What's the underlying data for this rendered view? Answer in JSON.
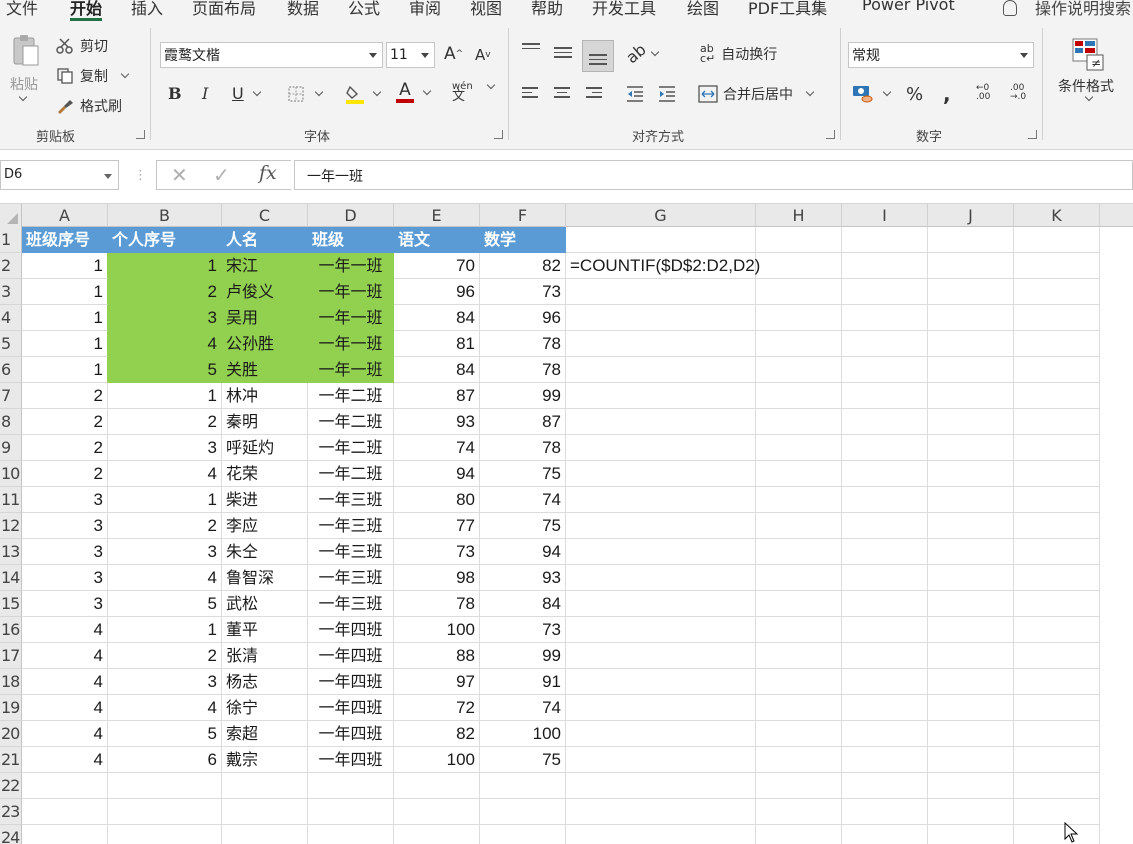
{
  "menu": {
    "tabs": [
      "文件",
      "开始",
      "插入",
      "页面布局",
      "数据",
      "公式",
      "审阅",
      "视图",
      "帮助",
      "开发工具",
      "绘图",
      "PDF工具集",
      "Power Pivot"
    ],
    "active": "开始",
    "search": "操作说明搜索"
  },
  "ribbon": {
    "clipboard": {
      "paste": "粘贴",
      "cut": "剪切",
      "copy": "复制",
      "format_painter": "格式刷",
      "label": "剪贴板"
    },
    "font": {
      "name": "霞鹜文楷",
      "size": "11",
      "bold": "B",
      "italic": "I",
      "underline": "U",
      "label": "字体"
    },
    "alignment": {
      "wrap": "自动换行",
      "merge": "合并后居中",
      "label": "对齐方式"
    },
    "number": {
      "format": "常规",
      "percent": "%",
      "comma": ",",
      "label": "数字"
    },
    "styles": {
      "conditional": "条件格式"
    }
  },
  "formula_bar": {
    "name_box": "D6",
    "formula": "一年一班"
  },
  "columns": [
    "A",
    "B",
    "C",
    "D",
    "E",
    "F",
    "G",
    "H",
    "I",
    "J",
    "K"
  ],
  "row_numbers": [
    "1",
    "2",
    "3",
    "4",
    "5",
    "6",
    "7",
    "8",
    "9",
    "10",
    "11",
    "12",
    "13",
    "14",
    "15",
    "16",
    "17",
    "18",
    "19",
    "20",
    "21",
    "22",
    "23",
    "24"
  ],
  "header_row": [
    "班级序号",
    "个人序号",
    "人名",
    "班级",
    "语文",
    "数学"
  ],
  "rows": [
    [
      "1",
      "1",
      "宋江",
      "一年一班",
      "70",
      "82"
    ],
    [
      "1",
      "2",
      "卢俊义",
      "一年一班",
      "96",
      "73"
    ],
    [
      "1",
      "3",
      "吴用",
      "一年一班",
      "84",
      "96"
    ],
    [
      "1",
      "4",
      "公孙胜",
      "一年一班",
      "81",
      "78"
    ],
    [
      "1",
      "5",
      "关胜",
      "一年一班",
      "84",
      "78"
    ],
    [
      "2",
      "1",
      "林冲",
      "一年二班",
      "87",
      "99"
    ],
    [
      "2",
      "2",
      "秦明",
      "一年二班",
      "93",
      "87"
    ],
    [
      "2",
      "3",
      "呼延灼",
      "一年二班",
      "74",
      "78"
    ],
    [
      "2",
      "4",
      "花荣",
      "一年二班",
      "94",
      "75"
    ],
    [
      "3",
      "1",
      "柴进",
      "一年三班",
      "80",
      "74"
    ],
    [
      "3",
      "2",
      "李应",
      "一年三班",
      "77",
      "75"
    ],
    [
      "3",
      "3",
      "朱仝",
      "一年三班",
      "73",
      "94"
    ],
    [
      "3",
      "4",
      "鲁智深",
      "一年三班",
      "98",
      "93"
    ],
    [
      "3",
      "5",
      "武松",
      "一年三班",
      "78",
      "84"
    ],
    [
      "4",
      "1",
      "董平",
      "一年四班",
      "100",
      "73"
    ],
    [
      "4",
      "2",
      "张清",
      "一年四班",
      "88",
      "99"
    ],
    [
      "4",
      "3",
      "杨志",
      "一年四班",
      "97",
      "91"
    ],
    [
      "4",
      "4",
      "徐宁",
      "一年四班",
      "72",
      "74"
    ],
    [
      "4",
      "5",
      "索超",
      "一年四班",
      "82",
      "100"
    ],
    [
      "4",
      "6",
      "戴宗",
      "一年四班",
      "100",
      "75"
    ]
  ],
  "g2_formula": "=COUNTIF($D$2:D2,D2)",
  "colors": {
    "header_fill": "#5b9bd5",
    "highlight_fill": "#92d050",
    "accent": "#217346"
  }
}
